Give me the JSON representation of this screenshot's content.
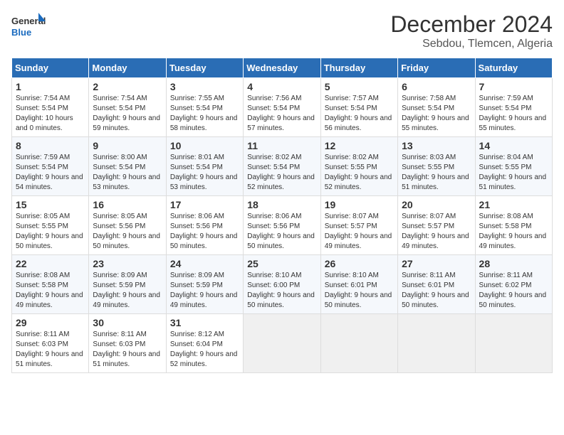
{
  "logo": {
    "line1": "General",
    "line2": "Blue"
  },
  "title": "December 2024",
  "subtitle": "Sebdou, Tlemcen, Algeria",
  "days_of_week": [
    "Sunday",
    "Monday",
    "Tuesday",
    "Wednesday",
    "Thursday",
    "Friday",
    "Saturday"
  ],
  "weeks": [
    [
      {
        "day": 1,
        "sunrise": "7:54 AM",
        "sunset": "5:54 PM",
        "daylight": "10 hours and 0 minutes."
      },
      {
        "day": 2,
        "sunrise": "7:54 AM",
        "sunset": "5:54 PM",
        "daylight": "9 hours and 59 minutes."
      },
      {
        "day": 3,
        "sunrise": "7:55 AM",
        "sunset": "5:54 PM",
        "daylight": "9 hours and 58 minutes."
      },
      {
        "day": 4,
        "sunrise": "7:56 AM",
        "sunset": "5:54 PM",
        "daylight": "9 hours and 57 minutes."
      },
      {
        "day": 5,
        "sunrise": "7:57 AM",
        "sunset": "5:54 PM",
        "daylight": "9 hours and 56 minutes."
      },
      {
        "day": 6,
        "sunrise": "7:58 AM",
        "sunset": "5:54 PM",
        "daylight": "9 hours and 55 minutes."
      },
      {
        "day": 7,
        "sunrise": "7:59 AM",
        "sunset": "5:54 PM",
        "daylight": "9 hours and 55 minutes."
      }
    ],
    [
      {
        "day": 8,
        "sunrise": "7:59 AM",
        "sunset": "5:54 PM",
        "daylight": "9 hours and 54 minutes."
      },
      {
        "day": 9,
        "sunrise": "8:00 AM",
        "sunset": "5:54 PM",
        "daylight": "9 hours and 53 minutes."
      },
      {
        "day": 10,
        "sunrise": "8:01 AM",
        "sunset": "5:54 PM",
        "daylight": "9 hours and 53 minutes."
      },
      {
        "day": 11,
        "sunrise": "8:02 AM",
        "sunset": "5:54 PM",
        "daylight": "9 hours and 52 minutes."
      },
      {
        "day": 12,
        "sunrise": "8:02 AM",
        "sunset": "5:55 PM",
        "daylight": "9 hours and 52 minutes."
      },
      {
        "day": 13,
        "sunrise": "8:03 AM",
        "sunset": "5:55 PM",
        "daylight": "9 hours and 51 minutes."
      },
      {
        "day": 14,
        "sunrise": "8:04 AM",
        "sunset": "5:55 PM",
        "daylight": "9 hours and 51 minutes."
      }
    ],
    [
      {
        "day": 15,
        "sunrise": "8:05 AM",
        "sunset": "5:55 PM",
        "daylight": "9 hours and 50 minutes."
      },
      {
        "day": 16,
        "sunrise": "8:05 AM",
        "sunset": "5:56 PM",
        "daylight": "9 hours and 50 minutes."
      },
      {
        "day": 17,
        "sunrise": "8:06 AM",
        "sunset": "5:56 PM",
        "daylight": "9 hours and 50 minutes."
      },
      {
        "day": 18,
        "sunrise": "8:06 AM",
        "sunset": "5:56 PM",
        "daylight": "9 hours and 50 minutes."
      },
      {
        "day": 19,
        "sunrise": "8:07 AM",
        "sunset": "5:57 PM",
        "daylight": "9 hours and 49 minutes."
      },
      {
        "day": 20,
        "sunrise": "8:07 AM",
        "sunset": "5:57 PM",
        "daylight": "9 hours and 49 minutes."
      },
      {
        "day": 21,
        "sunrise": "8:08 AM",
        "sunset": "5:58 PM",
        "daylight": "9 hours and 49 minutes."
      }
    ],
    [
      {
        "day": 22,
        "sunrise": "8:08 AM",
        "sunset": "5:58 PM",
        "daylight": "9 hours and 49 minutes."
      },
      {
        "day": 23,
        "sunrise": "8:09 AM",
        "sunset": "5:59 PM",
        "daylight": "9 hours and 49 minutes."
      },
      {
        "day": 24,
        "sunrise": "8:09 AM",
        "sunset": "5:59 PM",
        "daylight": "9 hours and 49 minutes."
      },
      {
        "day": 25,
        "sunrise": "8:10 AM",
        "sunset": "6:00 PM",
        "daylight": "9 hours and 50 minutes."
      },
      {
        "day": 26,
        "sunrise": "8:10 AM",
        "sunset": "6:01 PM",
        "daylight": "9 hours and 50 minutes."
      },
      {
        "day": 27,
        "sunrise": "8:11 AM",
        "sunset": "6:01 PM",
        "daylight": "9 hours and 50 minutes."
      },
      {
        "day": 28,
        "sunrise": "8:11 AM",
        "sunset": "6:02 PM",
        "daylight": "9 hours and 50 minutes."
      }
    ],
    [
      {
        "day": 29,
        "sunrise": "8:11 AM",
        "sunset": "6:03 PM",
        "daylight": "9 hours and 51 minutes."
      },
      {
        "day": 30,
        "sunrise": "8:11 AM",
        "sunset": "6:03 PM",
        "daylight": "9 hours and 51 minutes."
      },
      {
        "day": 31,
        "sunrise": "8:12 AM",
        "sunset": "6:04 PM",
        "daylight": "9 hours and 52 minutes."
      },
      null,
      null,
      null,
      null
    ]
  ],
  "labels": {
    "sunrise": "Sunrise:",
    "sunset": "Sunset:",
    "daylight": "Daylight:"
  }
}
